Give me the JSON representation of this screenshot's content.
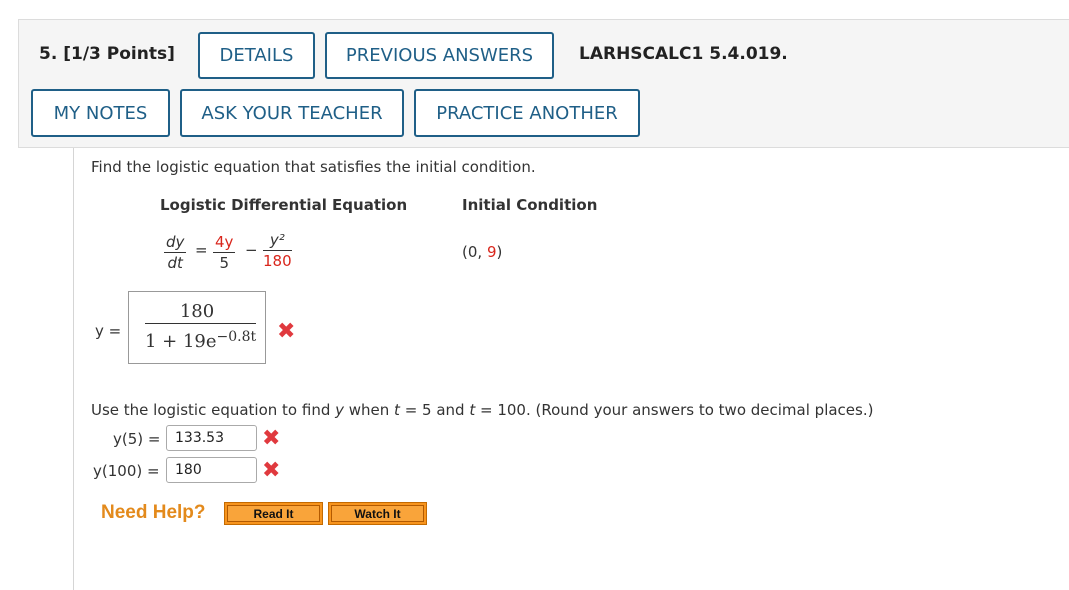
{
  "header": {
    "question_number": "5.",
    "points": "[1/3 Points]",
    "details_label": "DETAILS",
    "previous_answers_label": "PREVIOUS ANSWERS",
    "problem_code": "LARHSCALC1 5.4.019.",
    "my_notes_label": "MY NOTES",
    "ask_teacher_label": "ASK YOUR TEACHER",
    "practice_another_label": "PRACTICE ANOTHER"
  },
  "problem": {
    "prompt": "Find the logistic equation that satisfies the initial condition.",
    "col1_heading": "Logistic Differential Equation",
    "col2_heading": "Initial Condition",
    "de": {
      "lhs_num": "dy",
      "lhs_den": "dt",
      "equals": "=",
      "t1_num": "4y",
      "t1_den": "5",
      "minus": "−",
      "t2_num": "y²",
      "t2_den": "180"
    },
    "ic": {
      "open": "(0, ",
      "value": "9",
      "close": ")"
    }
  },
  "answer1": {
    "label": "y =",
    "numerator": "180",
    "den_base": "1 + 19e",
    "den_exp": "−0.8t"
  },
  "part2": {
    "prompt_a": "Use the logistic equation to find ",
    "y_var": "y",
    "prompt_b": " when  ",
    "t1": "t",
    "eq1": " = 5  and  ",
    "t2": "t",
    "eq2": " = 100.  (Round your answers to two decimal places.)",
    "y5_label": "y(5) =",
    "y5_value": "133.53",
    "y100_label": "y(100) =",
    "y100_value": "180"
  },
  "help": {
    "label": "Need Help?",
    "read_it": "Read It",
    "watch_it": "Watch It"
  },
  "colors": {
    "accent_blue": "#1f5f87",
    "incorrect_red": "#e0393e",
    "help_orange": "#e38a1c"
  }
}
